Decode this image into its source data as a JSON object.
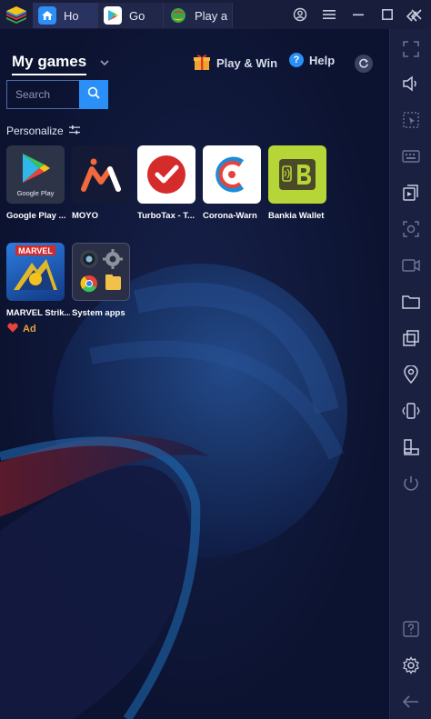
{
  "titlebar": {
    "tabs": [
      {
        "label": "Ho",
        "icon": "home-icon"
      },
      {
        "label": "Go",
        "icon": "google-play-icon"
      },
      {
        "label": "Play a",
        "icon": "game-ball-icon"
      }
    ],
    "controls": [
      "account-icon",
      "menu-icon",
      "minimize-icon",
      "maximize-icon",
      "close-icon"
    ]
  },
  "header": {
    "title": "My games",
    "play_win": "Play & Win",
    "help": "Help",
    "help_glyph": "?"
  },
  "search": {
    "placeholder": "Search"
  },
  "personalize": {
    "label": "Personalize"
  },
  "apps": [
    {
      "label": "Google Play ...",
      "icon_caption": "Google Play"
    },
    {
      "label": "MOYO"
    },
    {
      "label": "TurboTax - T..."
    },
    {
      "label": "Corona-Warn"
    },
    {
      "label": "Bankia Wallet"
    },
    {
      "label": "MARVEL Strik..."
    },
    {
      "label": "System apps"
    }
  ],
  "ad": {
    "label": "Ad"
  },
  "sidebar": {
    "buttons": [
      "fullscreen-icon",
      "volume-icon",
      "select-icon",
      "keyboard-icon",
      "media-manager-icon",
      "screenshot-icon",
      "record-icon",
      "folder-icon",
      "multi-instance-icon",
      "location-icon",
      "shake-icon",
      "device-rotate-icon",
      "eco-mode-icon",
      "help-icon",
      "settings-icon",
      "back-icon"
    ]
  },
  "colors": {
    "accent": "#2a8ff7",
    "background": "#0c1331",
    "sidebar": "#1a2040",
    "ad": "#e8a23c"
  }
}
